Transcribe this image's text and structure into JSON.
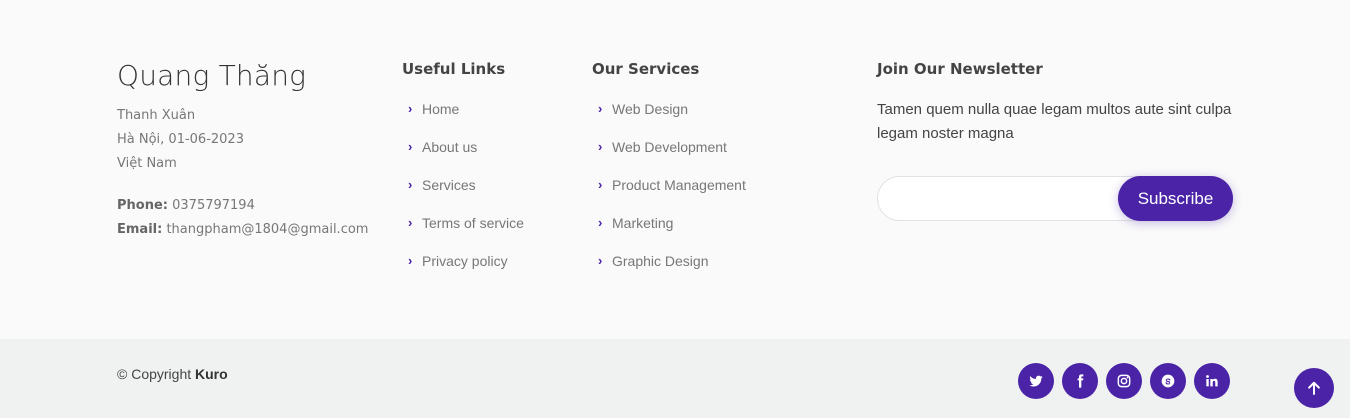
{
  "brand": {
    "name": "Quang Thăng",
    "address_lines": [
      "Thanh Xuân",
      "Hà Nội, 01-06-2023",
      "Việt Nam"
    ],
    "phone_label": "Phone:",
    "phone": "0375797194",
    "email_label": "Email:",
    "email": "thangpham@1804@gmail.com"
  },
  "useful_links": {
    "title": "Useful Links",
    "items": [
      "Home",
      "About us",
      "Services",
      "Terms of service",
      "Privacy policy"
    ]
  },
  "our_services": {
    "title": "Our Services",
    "items": [
      "Web Design",
      "Web Development",
      "Product Management",
      "Marketing",
      "Graphic Design"
    ]
  },
  "newsletter": {
    "title": "Join Our Newsletter",
    "text": "Tamen quem nulla quae legam multos aute sint culpa legam noster magna",
    "input_value": "",
    "button_label": "Subscribe"
  },
  "bottom": {
    "copyright_prefix": "© Copyright",
    "copyright_brand": "Kuro",
    "socials": [
      "twitter-icon",
      "facebook-icon",
      "instagram-icon",
      "skype-icon",
      "linkedin-icon"
    ]
  },
  "colors": {
    "accent": "#4b23a6",
    "top_bg": "#fafafa",
    "bottom_bg": "#f0f1f1"
  }
}
